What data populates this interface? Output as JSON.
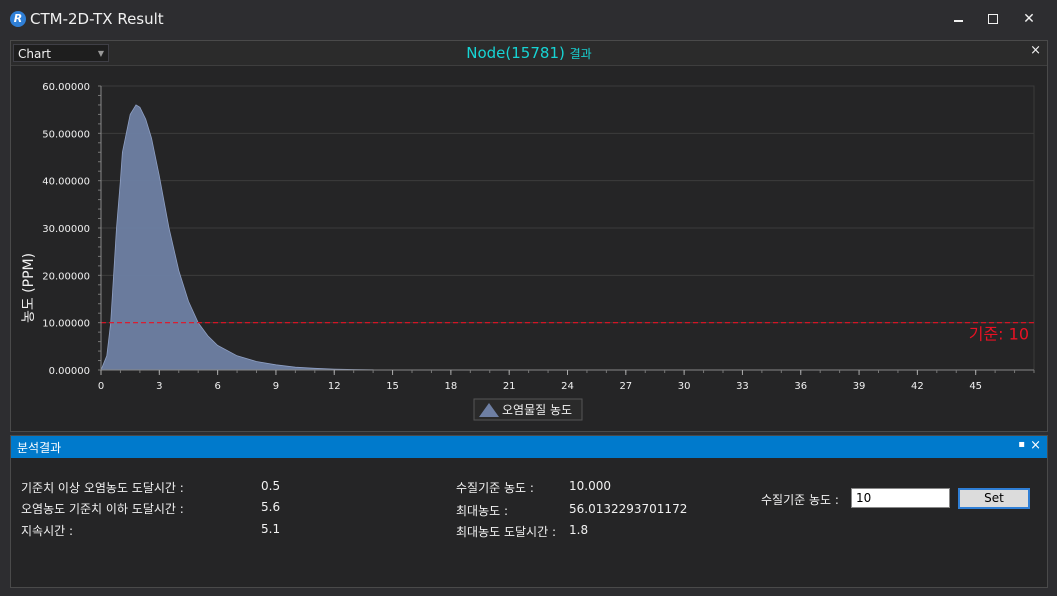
{
  "window": {
    "title": "CTM-2D-TX Result",
    "icon": "R",
    "controls": {
      "minimize": "minimize-icon",
      "maximize": "maximize-icon",
      "close": "close-icon"
    }
  },
  "chart_panel": {
    "view_select": "Chart",
    "title": "Node(15781)",
    "title_suffix": "결과",
    "close": "×"
  },
  "chart_data": {
    "type": "area",
    "ylabel": "농도 (PPM)",
    "xlim": [
      0,
      48
    ],
    "ylim": [
      0,
      60
    ],
    "x_ticks": [
      0,
      3,
      6,
      9,
      12,
      15,
      18,
      21,
      24,
      27,
      30,
      33,
      36,
      39,
      42,
      45
    ],
    "y_ticks": [
      "0.00000",
      "10.00000",
      "20.00000",
      "30.00000",
      "40.00000",
      "50.00000",
      "60.00000"
    ],
    "y_tick_values": [
      0,
      10,
      20,
      30,
      40,
      50,
      60
    ],
    "series": [
      {
        "name": "오염물질 농도",
        "color": "#6e7fa3",
        "x": [
          0,
          0.3,
          0.5,
          0.8,
          1.0,
          1.1,
          1.3,
          1.5,
          1.8,
          2.0,
          2.3,
          2.6,
          3.0,
          3.5,
          4.0,
          4.5,
          5.0,
          5.5,
          6.0,
          7.0,
          8.0,
          9.0,
          10.0,
          11.0,
          12.0,
          13.0,
          14.0
        ],
        "y": [
          0,
          3,
          10,
          30,
          40,
          46,
          50,
          54,
          56,
          55.5,
          53,
          49,
          41,
          30,
          21,
          14.5,
          10,
          7.2,
          5.2,
          3.0,
          1.8,
          1.1,
          0.6,
          0.35,
          0.2,
          0.1,
          0.05
        ]
      }
    ],
    "threshold": {
      "value": 10,
      "label": "기준: 10",
      "color": "#e81123"
    },
    "legend": {
      "placement": "bottom-center",
      "marker": "triangle-icon"
    },
    "grid": true
  },
  "analysis_panel": {
    "title": "분석결과",
    "pin": "▪",
    "close": "×",
    "rows_left": [
      {
        "label": "기준치 이상 오염농도 도달시간 :",
        "value": "0.5"
      },
      {
        "label": "오염농도 기준치 이하 도달시간 :",
        "value": "5.6"
      },
      {
        "label": "지속시간 :",
        "value": "5.1"
      }
    ],
    "rows_mid": [
      {
        "label": "수질기준 농도 :",
        "value": "10.000"
      },
      {
        "label": "최대농도 :",
        "value": "56.0132293701172"
      },
      {
        "label": "최대농도 도달시간 :",
        "value": "1.8"
      }
    ],
    "input_label": "수질기준 농도 :",
    "input_value": "10",
    "set_button": "Set"
  }
}
